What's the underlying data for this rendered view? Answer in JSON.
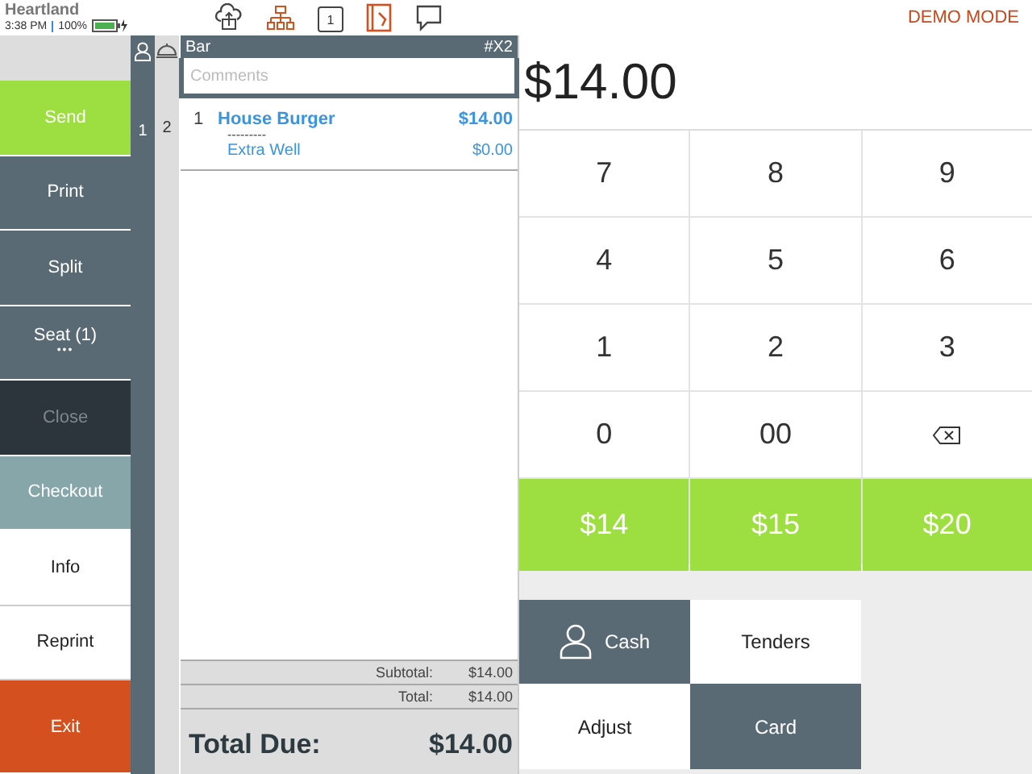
{
  "status_bar": {
    "carrier": "Heartland",
    "time": "3:38 PM",
    "battery": "100%",
    "mode": "DEMO MODE",
    "printer_number": "1"
  },
  "actions": [
    {
      "label": "Send",
      "kind": "green",
      "disabled": false
    },
    {
      "label": "Print",
      "kind": "slate",
      "disabled": false
    },
    {
      "label": "Split",
      "kind": "slate",
      "disabled": false
    },
    {
      "label": "Seat (1)",
      "kind": "slate",
      "disabled": false,
      "more": "•••"
    },
    {
      "label": "Close",
      "kind": "dark",
      "disabled": true
    },
    {
      "label": "Checkout",
      "kind": "teal",
      "disabled": false
    },
    {
      "label": "Info",
      "kind": "white",
      "disabled": false
    },
    {
      "label": "Reprint",
      "kind": "white",
      "disabled": false
    },
    {
      "label": "Exit",
      "kind": "orange",
      "disabled": false
    }
  ],
  "order": {
    "name": "Bar",
    "number": "#X2",
    "comments_placeholder": "Comments",
    "items": [
      {
        "seat": "1",
        "course": "2",
        "qty": "1",
        "name": "House Burger",
        "price": "$14.00",
        "separator": "---------",
        "modifier": "Extra Well",
        "modifier_price": "$0.00"
      }
    ],
    "subtotal_label": "Subtotal:",
    "subtotal": "$14.00",
    "total_label": "Total:",
    "total": "$14.00",
    "due_label": "Total Due:",
    "due": "$14.00"
  },
  "amount": "$14.00",
  "keypad": [
    {
      "kind": "key",
      "label": "7"
    },
    {
      "kind": "key",
      "label": "8"
    },
    {
      "kind": "key",
      "label": "9"
    },
    {
      "kind": "key",
      "label": "4"
    },
    {
      "kind": "key",
      "label": "5"
    },
    {
      "kind": "key",
      "label": "6"
    },
    {
      "kind": "key",
      "label": "1"
    },
    {
      "kind": "key",
      "label": "2"
    },
    {
      "kind": "key",
      "label": "3"
    },
    {
      "kind": "key",
      "label": "0"
    },
    {
      "kind": "key",
      "label": "00"
    },
    {
      "kind": "backspace"
    }
  ],
  "quick_amounts": [
    "$14",
    "$15",
    "$20"
  ],
  "tenders": [
    {
      "label": "Cash",
      "kind": "person"
    },
    {
      "label": "Tenders",
      "kind": "white"
    },
    {
      "label": "Adjust",
      "kind": "white"
    },
    {
      "label": "Card",
      "kind": "slate"
    }
  ]
}
